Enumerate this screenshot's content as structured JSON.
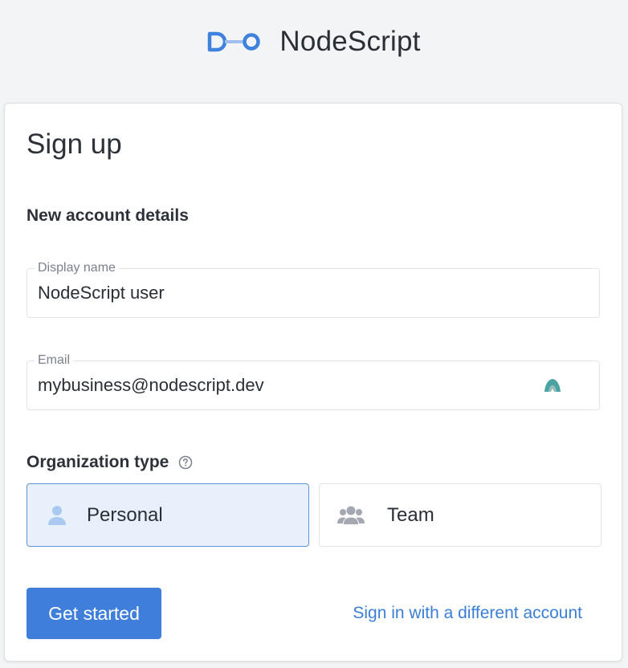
{
  "brand": {
    "name": "NodeScript",
    "color": "#3e82de"
  },
  "card": {
    "title": "Sign up",
    "section_title": "New account details"
  },
  "fields": {
    "display_name": {
      "label": "Display name",
      "value": "NodeScript user"
    },
    "email": {
      "label": "Email",
      "value": "mybusiness@nodescript.dev"
    }
  },
  "organization": {
    "title": "Organization type",
    "help_icon": "question-circle-icon",
    "options": [
      {
        "label": "Personal",
        "icon": "user-icon",
        "selected": true
      },
      {
        "label": "Team",
        "icon": "users-icon",
        "selected": false
      }
    ]
  },
  "actions": {
    "primary_label": "Get started",
    "secondary_label": "Sign in with a different account"
  },
  "colors": {
    "accent": "#3f7fdb",
    "selected_bg": "#e8f1fb",
    "selected_border": "#5e95d6",
    "link": "#3a7fd5",
    "indicator": "#4aa3a0"
  }
}
